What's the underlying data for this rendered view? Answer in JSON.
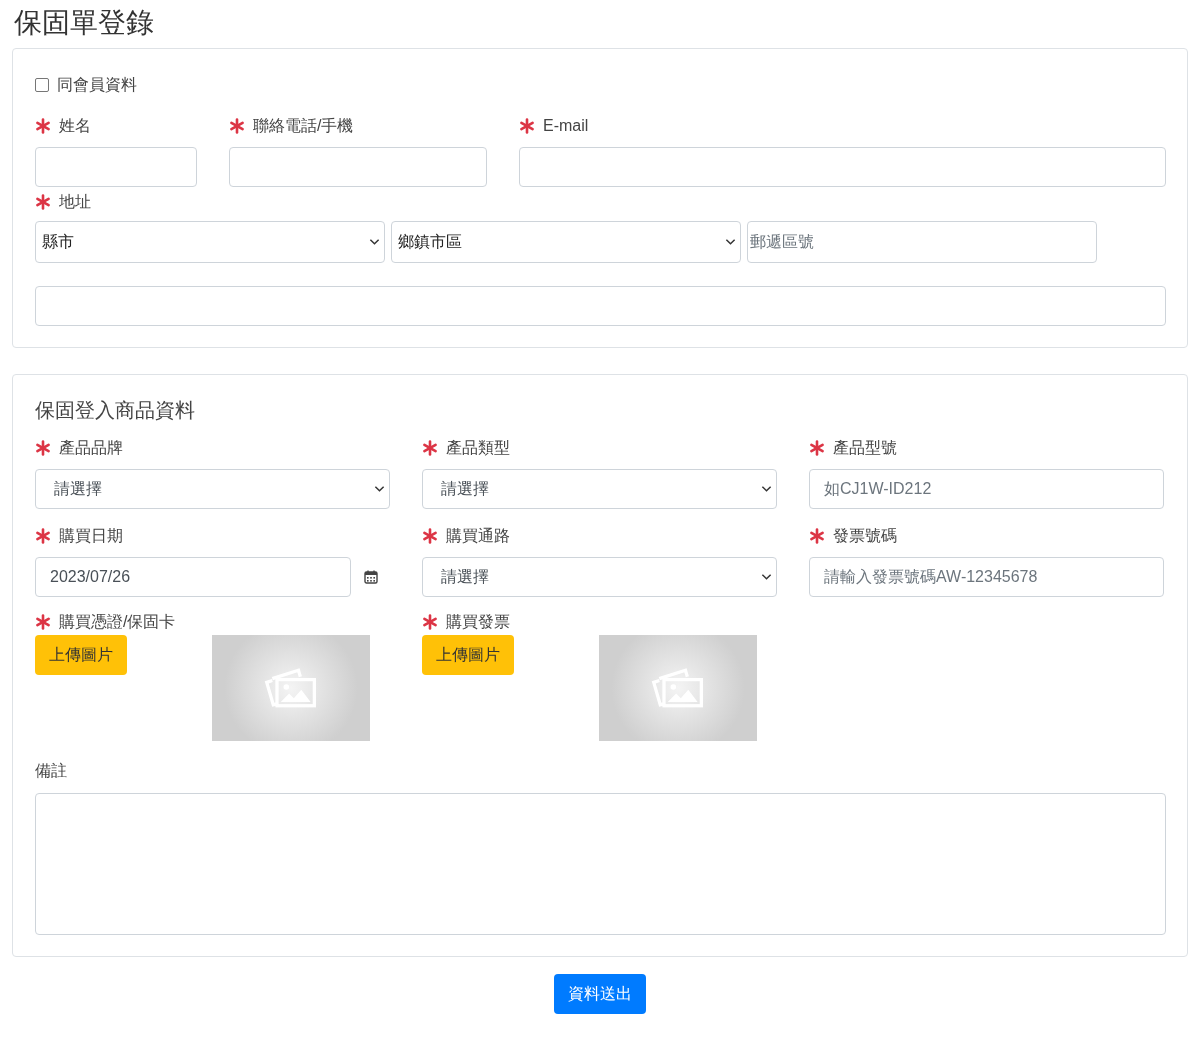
{
  "page_title": "保固單登錄",
  "member_section": {
    "same_as_member": {
      "label": "同會員資料",
      "checked": false
    },
    "fields": [
      {
        "label": "姓名",
        "required": true
      },
      {
        "label": "聯絡電話/手機",
        "required": true
      },
      {
        "label": "E-mail",
        "required": true
      }
    ],
    "address": {
      "label": "地址",
      "required": true,
      "city": "縣市",
      "district": "鄉鎮市區",
      "zip_placeholder": "郵遞區號"
    }
  },
  "product_section": {
    "title": "保固登入商品資料",
    "fields": [
      {
        "label": "產品品牌",
        "required": true,
        "kind": "select",
        "value": "請選擇"
      },
      {
        "label": "產品類型",
        "required": true,
        "kind": "select",
        "value": "請選擇"
      },
      {
        "label": "產品型號",
        "required": true,
        "kind": "text",
        "placeholder": "如CJ1W-ID212"
      },
      {
        "label": "購買日期",
        "required": true,
        "kind": "date",
        "value": "2023/07/26"
      },
      {
        "label": "購買通路",
        "required": true,
        "kind": "select",
        "value": "請選擇"
      },
      {
        "label": "發票號碼",
        "required": true,
        "kind": "text",
        "placeholder": "請輸入發票號碼AW-12345678"
      }
    ],
    "uploads": [
      {
        "label": "購買憑證/保固卡",
        "required": true,
        "button": "上傳圖片"
      },
      {
        "label": "購買發票",
        "required": true,
        "button": "上傳圖片"
      }
    ],
    "notes": {
      "label": "備註"
    }
  },
  "submit": "資料送出"
}
